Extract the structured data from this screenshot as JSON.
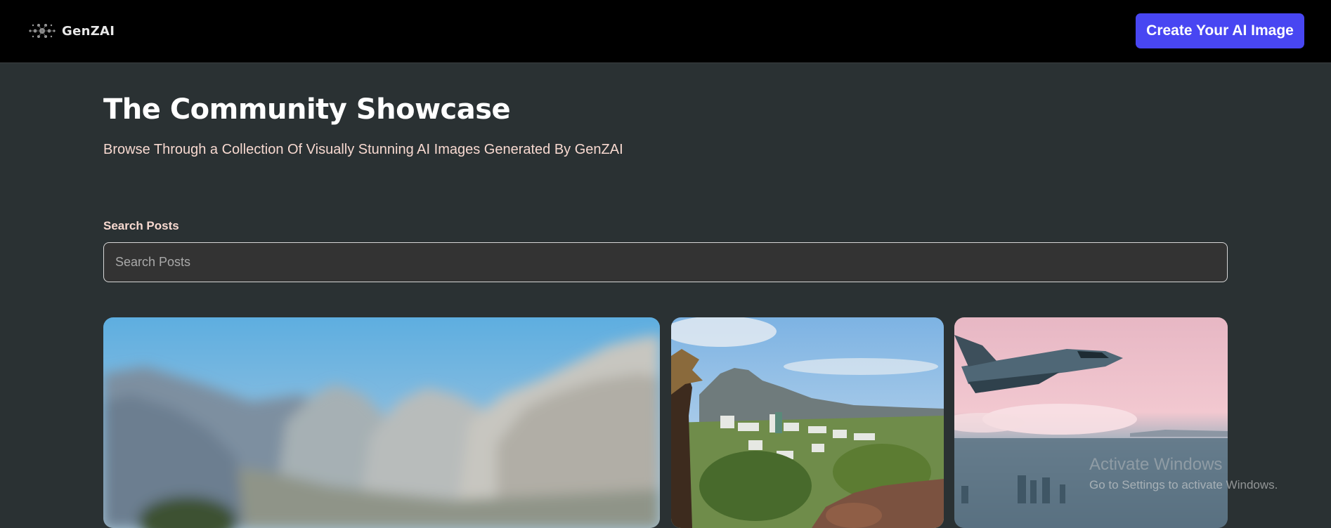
{
  "header": {
    "logo_text": "GenZAI",
    "create_button_label": "Create Your AI Image"
  },
  "main": {
    "title": "The Community Showcase",
    "subtitle": "Browse Through a Collection Of Visually Stunning AI Images Generated By GenZAI",
    "search": {
      "label": "Search Posts",
      "placeholder": "Search Posts",
      "value": ""
    },
    "gallery": [
      {
        "subject": "blurred mountain range under blue sky"
      },
      {
        "subject": "coastal town with mountain and palm tree"
      },
      {
        "subject": "space shuttle flying over pink clouds and ocean city"
      }
    ]
  },
  "system_overlay": {
    "title": "Activate Windows",
    "subtitle": "Go to Settings to activate Windows."
  },
  "colors": {
    "header_bg": "#000000",
    "page_bg": "#2a3133",
    "accent": "#4846f2",
    "subtitle_text": "#f7d9d0",
    "search_bg": "#333333"
  },
  "icons": {
    "logo": "genzai-logo-icon"
  }
}
